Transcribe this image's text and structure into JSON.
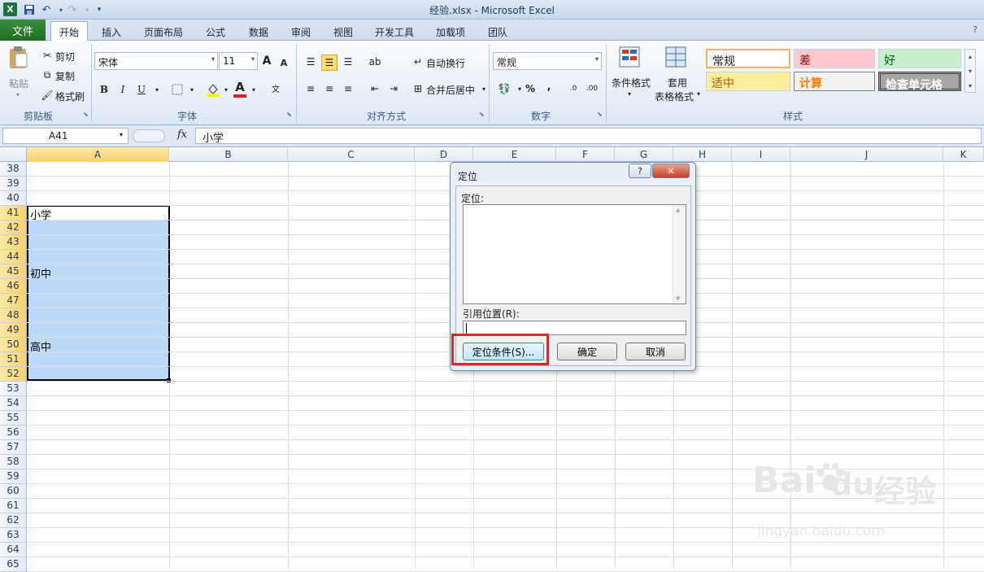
{
  "window": {
    "title": "经验.xlsx - Microsoft Excel"
  },
  "ribbon_tabs": [
    {
      "label": "文件"
    },
    {
      "label": "开始"
    },
    {
      "label": "插入"
    },
    {
      "label": "页面布局"
    },
    {
      "label": "公式"
    },
    {
      "label": "数据"
    },
    {
      "label": "审阅"
    },
    {
      "label": "视图"
    },
    {
      "label": "开发工具"
    },
    {
      "label": "加载项"
    },
    {
      "label": "团队"
    }
  ],
  "clipboard": {
    "paste": "粘贴",
    "cut": "剪切",
    "copy": "复制",
    "format_painter": "格式刷",
    "group": "剪贴板"
  },
  "font": {
    "name": "宋体",
    "size": "11",
    "bold": "B",
    "italic": "I",
    "underline": "U",
    "group": "字体",
    "grow": "A",
    "shrink": "A",
    "color_a": "A"
  },
  "alignment": {
    "wrap": "自动换行",
    "merge": "合并后居中",
    "group": "对齐方式"
  },
  "number": {
    "format": "常规",
    "percent": "%",
    "comma": ",",
    "group": "数字"
  },
  "styles_group": {
    "cond_format": "条件格式",
    "table_format_1": "套用",
    "table_format_2": "表格格式",
    "cells": [
      {
        "label": "常规"
      },
      {
        "label": "差"
      },
      {
        "label": "好"
      },
      {
        "label": "适中"
      },
      {
        "label": "计算"
      },
      {
        "label": "检查单元格"
      }
    ],
    "group": "样式"
  },
  "formula_bar": {
    "name_box": "A41",
    "fx": "fx",
    "content": "小学"
  },
  "columns": [
    "A",
    "B",
    "C",
    "D",
    "E",
    "F",
    "G",
    "H",
    "I",
    "J",
    "K"
  ],
  "rows": [
    "38",
    "39",
    "40",
    "41",
    "42",
    "43",
    "44",
    "45",
    "46",
    "47",
    "48",
    "49",
    "50",
    "51",
    "52",
    "53",
    "54",
    "55",
    "56",
    "57",
    "58",
    "59",
    "60",
    "61",
    "62",
    "63",
    "64",
    "65"
  ],
  "cells": {
    "A41": "小学",
    "A45": "初中",
    "A50": "高中"
  },
  "dialog": {
    "title": "定位",
    "help": "?",
    "close": "✕",
    "goto_label": "定位:",
    "reference_label": "引用位置(R):",
    "reference_value": "",
    "special_button": "定位条件(S)...",
    "ok_button": "确定",
    "cancel_button": "取消"
  },
  "watermark": {
    "brand": "Bai",
    "du": "du",
    "cn": "经验",
    "site": "jingyan.baidu.com"
  }
}
